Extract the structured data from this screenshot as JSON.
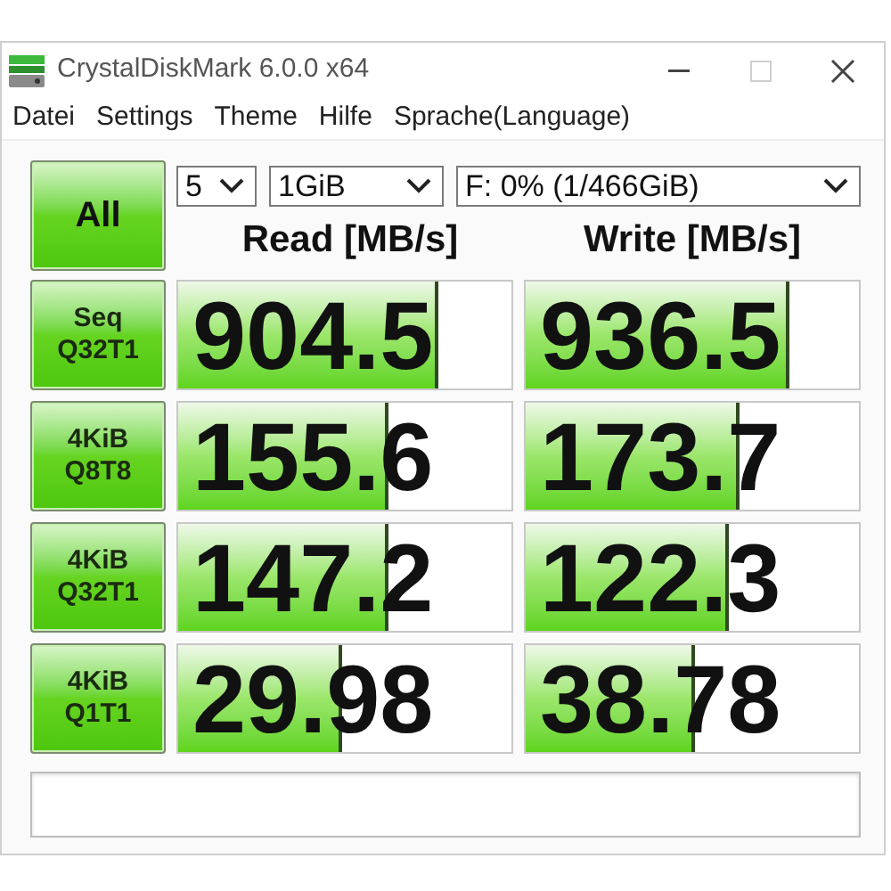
{
  "window": {
    "title": "CrystalDiskMark 6.0.0 x64"
  },
  "menu": [
    "Datei",
    "Settings",
    "Theme",
    "Hilfe",
    "Sprache(Language)"
  ],
  "all_button": "All",
  "selects": {
    "count": "5",
    "size": "1GiB",
    "drive": "F: 0% (1/466GiB)"
  },
  "headers": {
    "read": "Read [MB/s]",
    "write": "Write [MB/s]"
  },
  "rows": [
    {
      "label": [
        "Seq",
        "Q32T1"
      ],
      "read": {
        "value": "904.5",
        "level": 0.78
      },
      "write": {
        "value": "936.5",
        "level": 0.79
      }
    },
    {
      "label": [
        "4KiB",
        "Q8T8"
      ],
      "read": {
        "value": "155.6",
        "level": 0.63
      },
      "write": {
        "value": "173.7",
        "level": 0.64
      }
    },
    {
      "label": [
        "4KiB",
        "Q32T1"
      ],
      "read": {
        "value": "147.2",
        "level": 0.63
      },
      "write": {
        "value": "122.3",
        "level": 0.61
      }
    },
    {
      "label": [
        "4KiB",
        "Q1T1"
      ],
      "read": {
        "value": "29.98",
        "level": 0.49
      },
      "write": {
        "value": "38.78",
        "level": 0.51
      }
    }
  ]
}
